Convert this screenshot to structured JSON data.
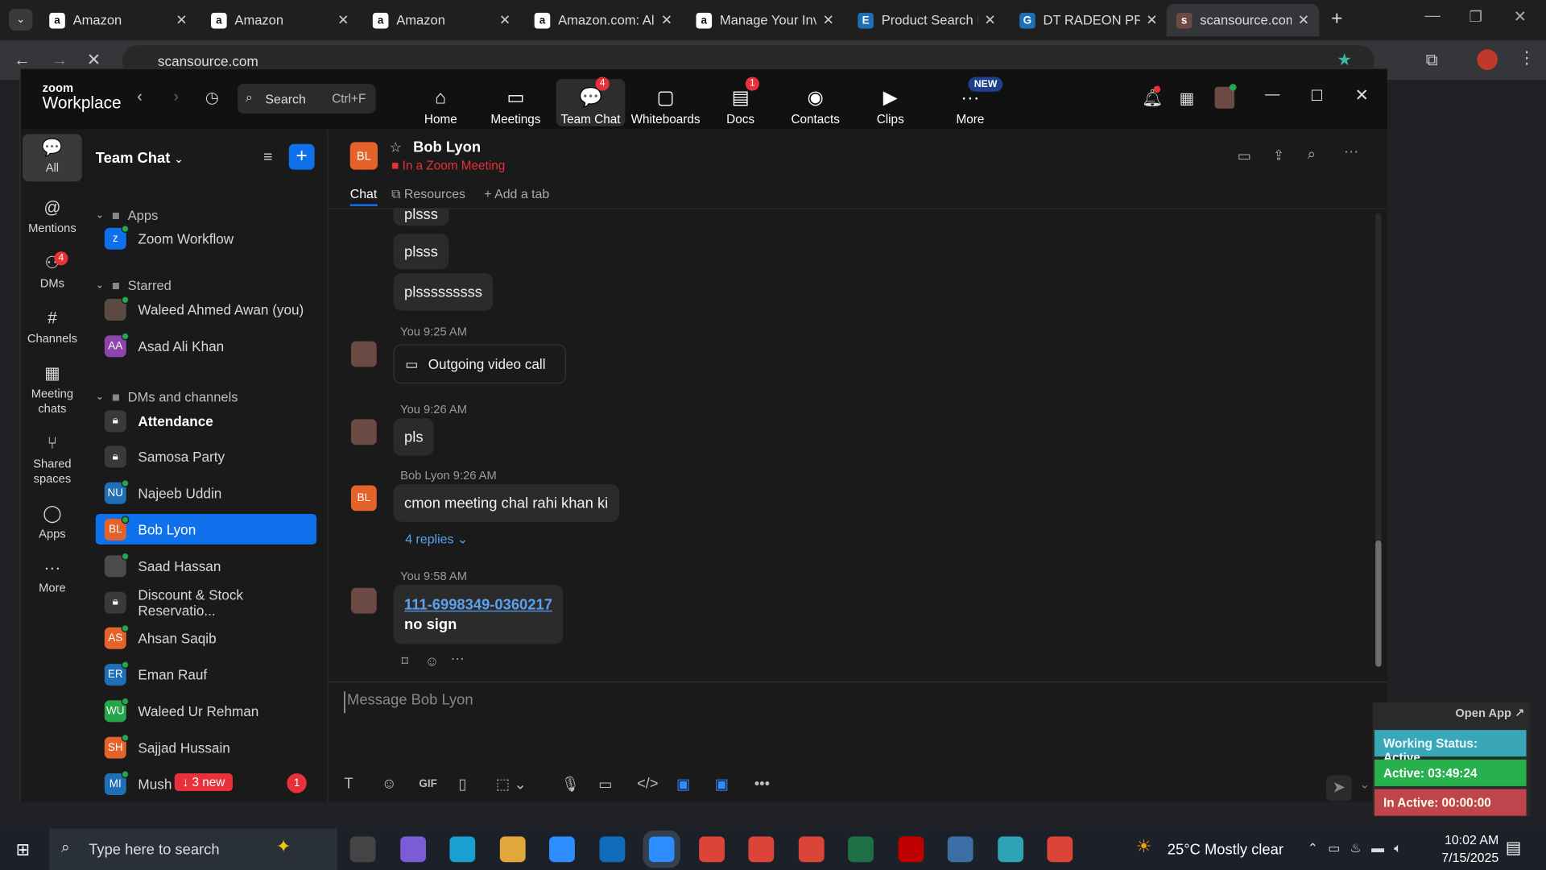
{
  "browser": {
    "tabs": [
      {
        "title": "Amazon",
        "icon": "amazon-icon"
      },
      {
        "title": "Amazon",
        "icon": "amazon-icon"
      },
      {
        "title": "Amazon",
        "icon": "amazon-icon"
      },
      {
        "title": "Amazon.com: Al",
        "icon": "amazon-icon"
      },
      {
        "title": "Manage Your Inv",
        "icon": "amazon-icon"
      },
      {
        "title": "Product Search R",
        "icon": "ec-icon"
      },
      {
        "title": "DT RADEON PRO",
        "icon": "site-icon"
      },
      {
        "title": "scansource.com",
        "icon": "scansource-icon"
      }
    ],
    "url": "scansource.com"
  },
  "zoom": {
    "logo_top": "zoom",
    "logo_bottom": "Workplace",
    "search_label": "Search",
    "search_shortcut": "Ctrl+F",
    "nav": [
      {
        "label": "Home",
        "icon": "home-icon",
        "glyph": "⌂"
      },
      {
        "label": "Meetings",
        "icon": "video-icon",
        "glyph": "▭"
      },
      {
        "label": "Team Chat",
        "icon": "chat-icon",
        "glyph": "💬",
        "badge": "4"
      },
      {
        "label": "Whiteboards",
        "icon": "whiteboard-icon",
        "glyph": "▢"
      },
      {
        "label": "Docs",
        "icon": "docs-icon",
        "glyph": "▤",
        "badge": "1"
      },
      {
        "label": "Contacts",
        "icon": "contacts-icon",
        "glyph": "◉"
      },
      {
        "label": "Clips",
        "icon": "clips-icon",
        "glyph": "▶"
      },
      {
        "label": "More",
        "icon": "more-icon",
        "glyph": "···",
        "tag": "NEW"
      }
    ],
    "rail": [
      {
        "label": "All",
        "glyph": "💬"
      },
      {
        "label": "Mentions",
        "glyph": "@"
      },
      {
        "label": "DMs",
        "glyph": "⚇",
        "badge": "4"
      },
      {
        "label": "Channels",
        "glyph": "#"
      },
      {
        "label": "Meeting chats",
        "glyph": "▦"
      },
      {
        "label": "Shared spaces",
        "glyph": "⑂"
      },
      {
        "label": "Apps",
        "glyph": "◯"
      },
      {
        "label": "More",
        "glyph": "···"
      }
    ],
    "sidebar": {
      "title": "Team Chat",
      "sections": {
        "apps": "Apps",
        "starred": "Starred",
        "dms": "DMs and channels"
      },
      "apps": [
        {
          "name": "Zoom Workflow"
        }
      ],
      "starred": [
        {
          "name": "Waleed Ahmed Awan (you)",
          "initials": "",
          "color": "#5a4a42"
        },
        {
          "name": "Asad Ali Khan",
          "initials": "AA",
          "color": "#8e44ad"
        }
      ],
      "items": [
        {
          "name": "Attendance",
          "lock": true,
          "bold": true
        },
        {
          "name": "Samosa Party",
          "lock": true
        },
        {
          "name": "Najeeb Uddin",
          "initials": "NU",
          "color": "#1e6fb5"
        },
        {
          "name": "Bob Lyon",
          "initials": "BL",
          "color": "#e5632b",
          "selected": true
        },
        {
          "name": "Saad Hassan",
          "initials": "",
          "color": "#4b4b4b"
        },
        {
          "name": "Discount & Stock Reservatio...",
          "lock": true
        },
        {
          "name": "Ahsan Saqib",
          "initials": "AS",
          "color": "#e5632b"
        },
        {
          "name": "Eman Rauf",
          "initials": "ER",
          "color": "#1e6fb5"
        },
        {
          "name": "Waleed Ur Rehman",
          "initials": "WU",
          "color": "#27a54a"
        },
        {
          "name": "Sajjad Hussain",
          "initials": "SH",
          "color": "#e5632b"
        },
        {
          "name": "Mush",
          "initials": "MI",
          "color": "#1e6fb5",
          "unread": "1"
        }
      ],
      "new_pill": "↓ 3 new"
    },
    "chat": {
      "contact": "Bob Lyon",
      "contact_initials": "BL",
      "status": "In a Zoom Meeting",
      "tabs": [
        "Chat",
        "Resources",
        "+ Add a tab"
      ],
      "messages": [
        {
          "text": "plsss"
        },
        {
          "text": "plsss"
        },
        {
          "text": "plsssssssss"
        },
        {
          "meta": "You 9:25 AM",
          "text": "Outgoing video call"
        },
        {
          "meta": "You 9:26 AM",
          "text": "pls"
        },
        {
          "meta": "Bob Lyon 9:26 AM",
          "text": "cmon meeting chal rahi khan ki",
          "replies": "4 replies"
        },
        {
          "meta": "You 9:58 AM",
          "link": "111-6998349-0360217",
          "text": "no sign"
        }
      ],
      "composer_placeholder": "Message Bob Lyon"
    }
  },
  "widget": {
    "open_app": "Open App ↗",
    "working_status": "Working Status: Active",
    "active": "Active: 03:49:24",
    "inactive": "In Active: 00:00:00"
  },
  "taskbar": {
    "search_placeholder": "Type here to search",
    "weather": "25°C  Mostly clear",
    "time": "10:02 AM",
    "date": "7/15/2025"
  }
}
